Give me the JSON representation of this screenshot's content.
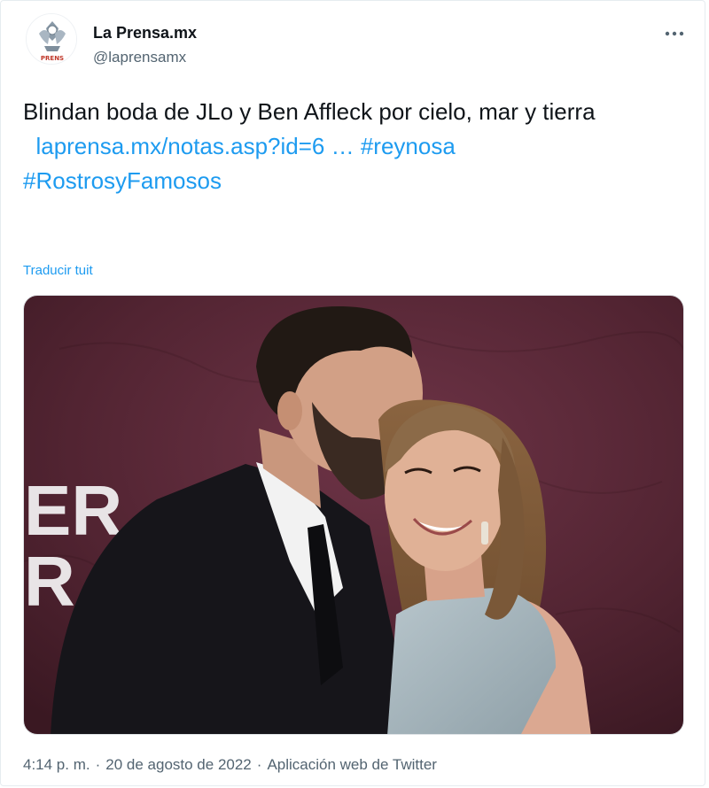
{
  "author": {
    "name": "La Prensa.mx",
    "handle": "@laprensamx",
    "avatar_icon": "la-prensa-logo",
    "avatar_text": "PRENS"
  },
  "menu": {
    "more_icon": "more-horizontal-icon"
  },
  "tweet": {
    "text_line": "Blindan boda de JLo y Ben Affleck por cielo, mar y tierra",
    "link": "laprensa.mx/notas.asp?id=6 …",
    "hashtags": [
      "#reynosa",
      "#RostrosyFamosos"
    ]
  },
  "translate_label": "Traducir tuit",
  "media": {
    "backdrop_text": [
      "ER",
      "R"
    ]
  },
  "meta": {
    "time": "4:14 p. m.",
    "separator": "·",
    "date": "20 de agosto de 2022",
    "source": "Aplicación web de Twitter"
  },
  "colors": {
    "link": "#1d9bf0",
    "text": "#0f1419",
    "secondary": "#536471",
    "backdrop": "#5a2a3a"
  }
}
